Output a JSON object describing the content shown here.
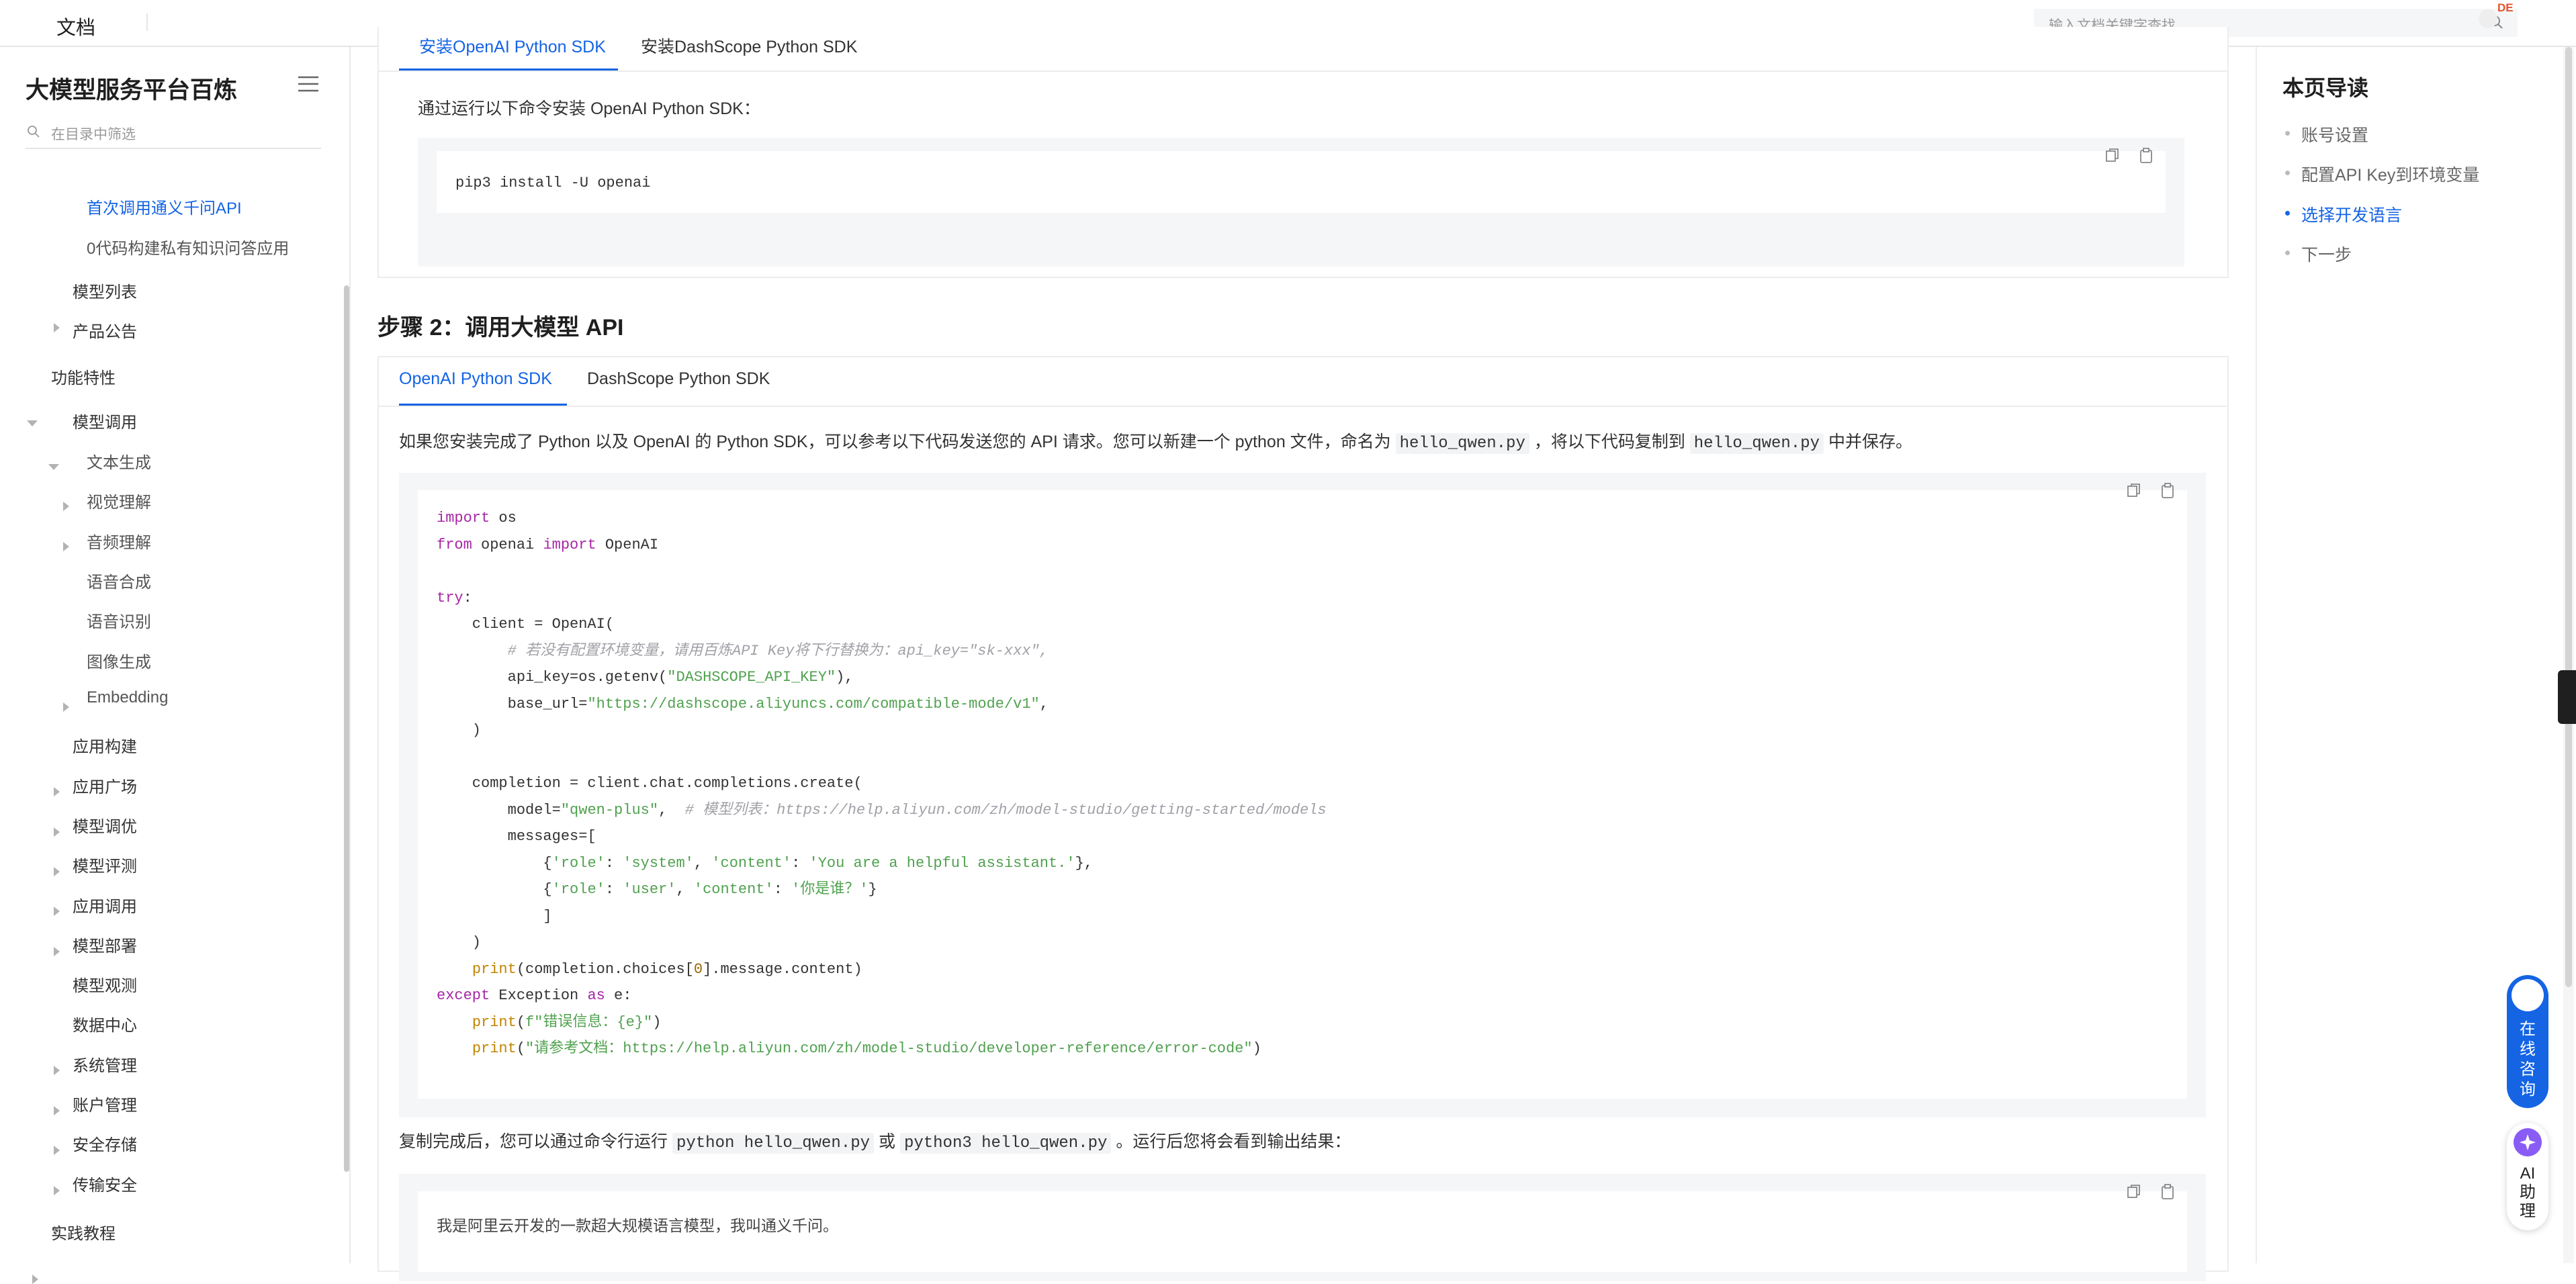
{
  "topbar": {
    "brand": "文档",
    "search_placeholder": "输入文档关键字查找",
    "lang_badge": "DE"
  },
  "sidebar": {
    "title": "大模型服务平台百炼",
    "filter_placeholder": "在目录中筛选",
    "items": [
      {
        "label": "首次调用通义千问API",
        "active": true
      },
      {
        "label": "0代码构建私有知识问答应用"
      },
      {
        "label": "模型列表"
      },
      {
        "label": "产品公告"
      },
      {
        "label": "功能特性"
      },
      {
        "label": "模型调用"
      },
      {
        "label": "文本生成"
      },
      {
        "label": "视觉理解"
      },
      {
        "label": "音频理解"
      },
      {
        "label": "语音合成"
      },
      {
        "label": "语音识别"
      },
      {
        "label": "图像生成"
      },
      {
        "label": "Embedding"
      },
      {
        "label": "应用构建"
      },
      {
        "label": "应用广场"
      },
      {
        "label": "模型调优"
      },
      {
        "label": "模型评测"
      },
      {
        "label": "应用调用"
      },
      {
        "label": "模型部署"
      },
      {
        "label": "模型观测"
      },
      {
        "label": "数据中心"
      },
      {
        "label": "系统管理"
      },
      {
        "label": "账户管理"
      },
      {
        "label": "安全存储"
      },
      {
        "label": "传输安全"
      },
      {
        "label": "实践教程"
      }
    ]
  },
  "main": {
    "install_block": {
      "tabs": [
        "安装OpenAI Python SDK",
        "安装DashScope Python SDK"
      ],
      "desc": "通过运行以下命令安装 OpenAI Python SDK：",
      "code": "pip3 install -U openai"
    },
    "step2": {
      "heading": "步骤 2：调用大模型 API",
      "tabs": [
        "OpenAI Python SDK",
        "DashScope Python SDK"
      ],
      "para_parts": [
        "如果您安装完成了 Python 以及 OpenAI 的 Python SDK，可以参考以下代码发送您的 API 请求。您可以新建一个 python 文件，命名为",
        "hello_qwen.py",
        "，将以下代码复制到",
        "hello_qwen.py",
        "中并保存。"
      ],
      "code_lines": [
        "import os",
        "from openai import OpenAI",
        "",
        "try:",
        "    client = OpenAI(",
        "        # 若没有配置环境变量，请用百炼API Key将下行替换为：api_key=\"sk-xxx\",",
        "        api_key=os.getenv(\"DASHSCOPE_API_KEY\"),",
        "        base_url=\"https://dashscope.aliyuncs.com/compatible-mode/v1\",",
        "    )",
        "",
        "    completion = client.chat.completions.create(",
        "        model=\"qwen-plus\",  # 模型列表：https://help.aliyun.com/zh/model-studio/getting-started/models",
        "        messages=[",
        "            {'role': 'system', 'content': 'You are a helpful assistant.'},",
        "            {'role': 'user', 'content': '你是谁？'}",
        "            ]",
        "    )",
        "    print(completion.choices[0].message.content)",
        "except Exception as e:",
        "    print(f\"错误信息：{e}\")",
        "    print(\"请参考文档：https://help.aliyun.com/zh/model-studio/developer-reference/error-code\")"
      ],
      "after_parts": [
        "复制完成后，您可以通过命令行运行",
        "python hello_qwen.py",
        "或",
        "python3 hello_qwen.py",
        "。运行后您将会看到输出结果："
      ],
      "output": "我是阿里云开发的一款超大规模语言模型，我叫通义千问。"
    }
  },
  "toc": {
    "title": "本页导读",
    "items": [
      {
        "label": "账号设置"
      },
      {
        "label": "配置API Key到环境变量"
      },
      {
        "label": "选择开发语言",
        "active": true
      },
      {
        "label": "下一步"
      }
    ]
  },
  "floating": {
    "consult_label": "在线咨询",
    "ai_label": "AI助理"
  },
  "colors": {
    "accent": "#1464e4",
    "keyword": "#a626a4",
    "string": "#50a14f",
    "comment": "#a0a1a7",
    "builtin": "#c18401"
  }
}
